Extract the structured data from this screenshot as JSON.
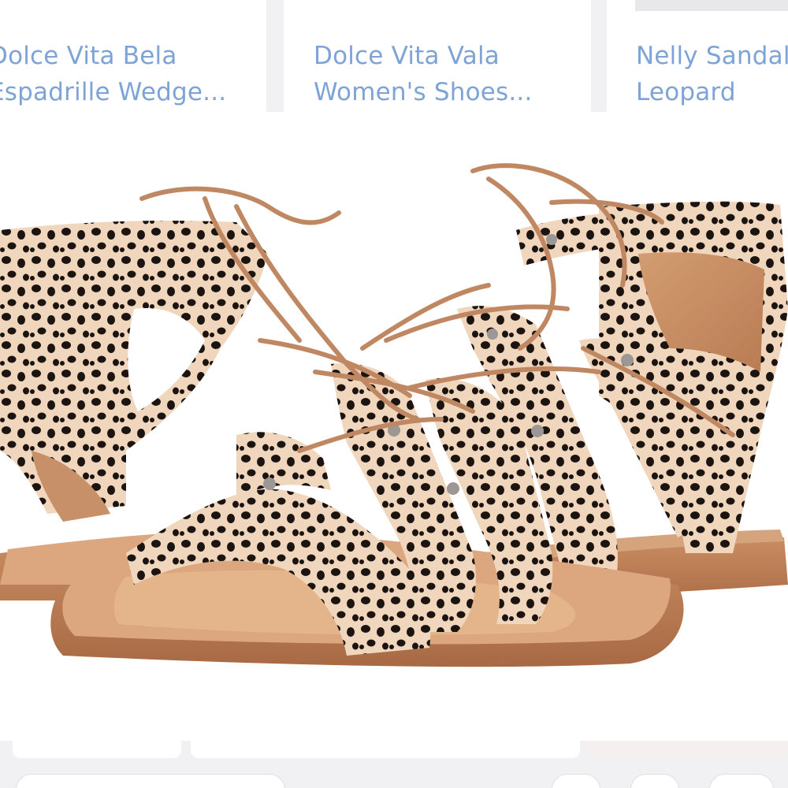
{
  "recommendations": [
    {
      "line1": "Dolce Vita Bela",
      "line2": "Espadrille Wedge..."
    },
    {
      "line1": "Dolce Vita Vala",
      "line2": "Women's Shoes..."
    },
    {
      "line1": "Nelly Sandal",
      "line2": "Leopard"
    }
  ],
  "product_image": {
    "icon": "leopard-gladiator-sandals-image"
  },
  "colors": {
    "link_text": "#7ea3d6",
    "background": "#f1f1f3",
    "strap_base": "#efd6bd",
    "spot": "#1c1410",
    "sole": "#b77a52",
    "lace": "#c08862"
  }
}
